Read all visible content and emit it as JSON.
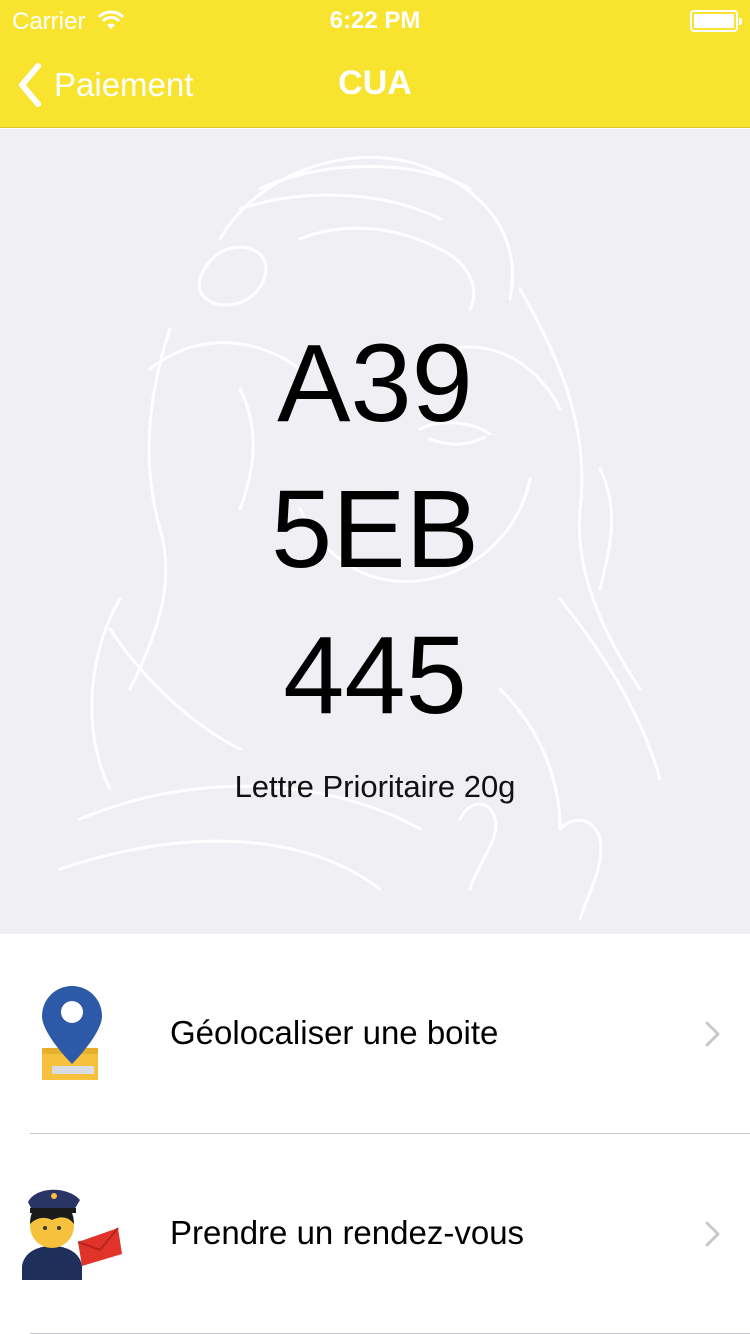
{
  "status_bar": {
    "carrier": "Carrier",
    "time": "6:22 PM",
    "battery_level": 1.0
  },
  "nav": {
    "back_label": "Paiement",
    "title": "CUA"
  },
  "code": {
    "line1": "A39",
    "line2": "5EB",
    "line3": "445",
    "product": "Lettre Prioritaire 20g"
  },
  "menu": {
    "items": [
      {
        "label": "Géolocaliser une boite",
        "icon": "map-pin-mailbox-icon"
      },
      {
        "label": "Prendre un rendez-vous",
        "icon": "postman-letter-icon"
      }
    ]
  },
  "colors": {
    "header": "#f8e42e",
    "panel": "#efeff4",
    "pin_blue": "#2c5aa8",
    "separator": "#c8c7cc",
    "chevron": "#c7c7cc"
  }
}
